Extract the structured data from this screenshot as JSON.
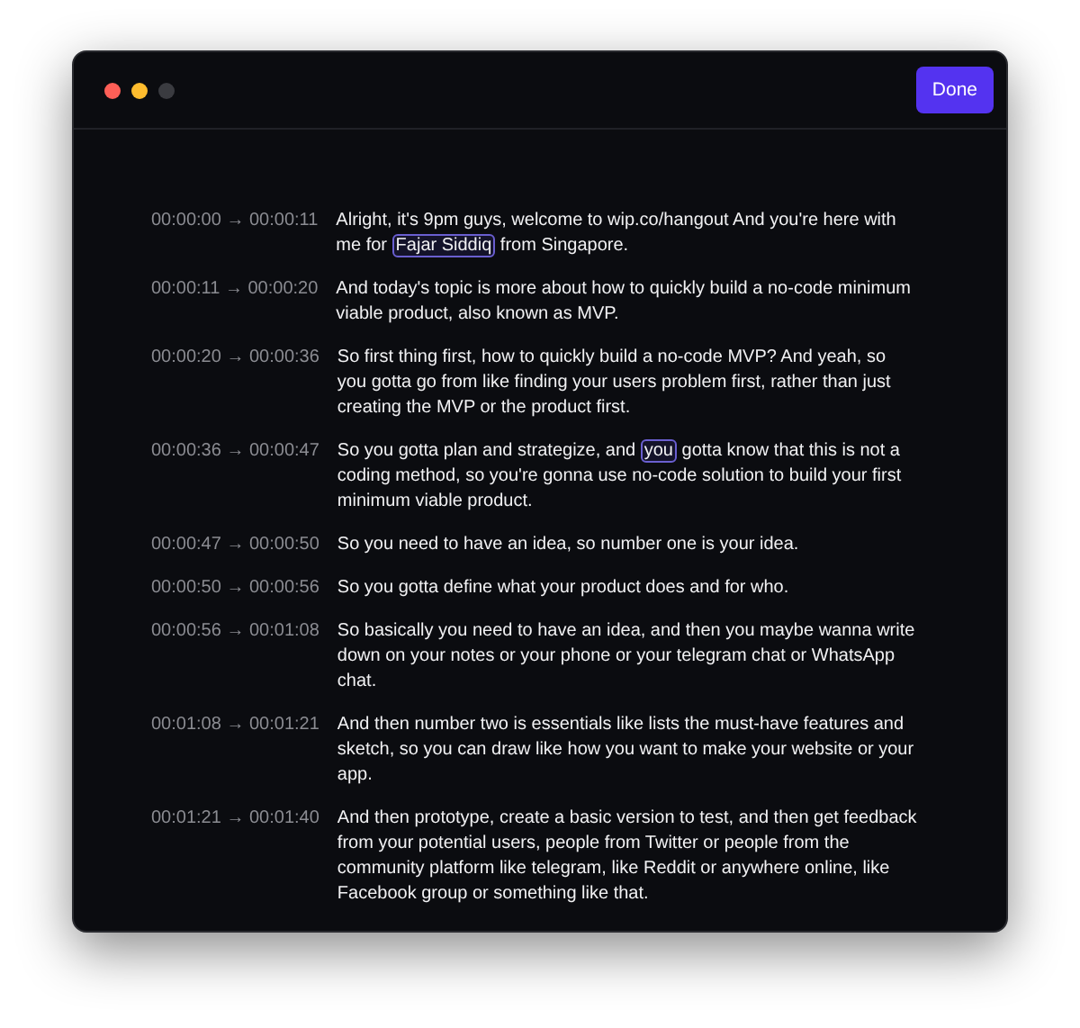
{
  "window": {
    "traffic_lights": [
      {
        "color": "#fe5f57"
      },
      {
        "color": "#febc2e"
      },
      {
        "color": "#3a3b40"
      }
    ]
  },
  "done_button": "Done",
  "transcript": [
    {
      "time": "00:00:00 → 00:00:11",
      "segments": [
        {
          "text": "Alright, it's 9pm guys, welcome to wip.co/hangout And you're here with me for ",
          "highlighted": false
        },
        {
          "text": "Fajar Siddiq",
          "highlighted": true
        },
        {
          "text": " from Singapore.",
          "highlighted": false
        }
      ]
    },
    {
      "time": "00:00:11 → 00:00:20",
      "segments": [
        {
          "text": "And today's topic is more about how to quickly build a no-code minimum viable product, also known as MVP.",
          "highlighted": false
        }
      ]
    },
    {
      "time": "00:00:20 → 00:00:36",
      "segments": [
        {
          "text": "So first thing first, how to quickly build a no-code MVP? And yeah, so you gotta go from like finding your users problem first, rather than just creating the MVP or the product first.",
          "highlighted": false
        }
      ]
    },
    {
      "time": "00:00:36 → 00:00:47",
      "segments": [
        {
          "text": "So you gotta plan and strategize, and ",
          "highlighted": false
        },
        {
          "text": "you",
          "highlighted": true
        },
        {
          "text": " gotta know that this is not a coding method, so you're gonna use no-code solution to build your first minimum viable product.",
          "highlighted": false
        }
      ]
    },
    {
      "time": "00:00:47 → 00:00:50",
      "segments": [
        {
          "text": "So you need to have an idea, so number one is your idea.",
          "highlighted": false
        }
      ]
    },
    {
      "time": "00:00:50 → 00:00:56",
      "segments": [
        {
          "text": "So you gotta define what your product does and for who.",
          "highlighted": false
        }
      ]
    },
    {
      "time": "00:00:56 → 00:01:08",
      "segments": [
        {
          "text": "So basically you need to have an idea, and then you maybe wanna write down on your notes or your phone or your telegram chat or WhatsApp chat.",
          "highlighted": false
        }
      ]
    },
    {
      "time": "00:01:08 → 00:01:21",
      "segments": [
        {
          "text": "And then number two is essentials like lists the must-have features and sketch, so you can draw like how you want to make your website or your app.",
          "highlighted": false
        }
      ]
    },
    {
      "time": "00:01:21 → 00:01:40",
      "segments": [
        {
          "text": "And then prototype, create a basic version to test, and then get feedback from your potential users, people from Twitter or people from the community platform like telegram, like Reddit or anywhere online, like Facebook group or something like that.",
          "highlighted": false
        }
      ]
    }
  ]
}
